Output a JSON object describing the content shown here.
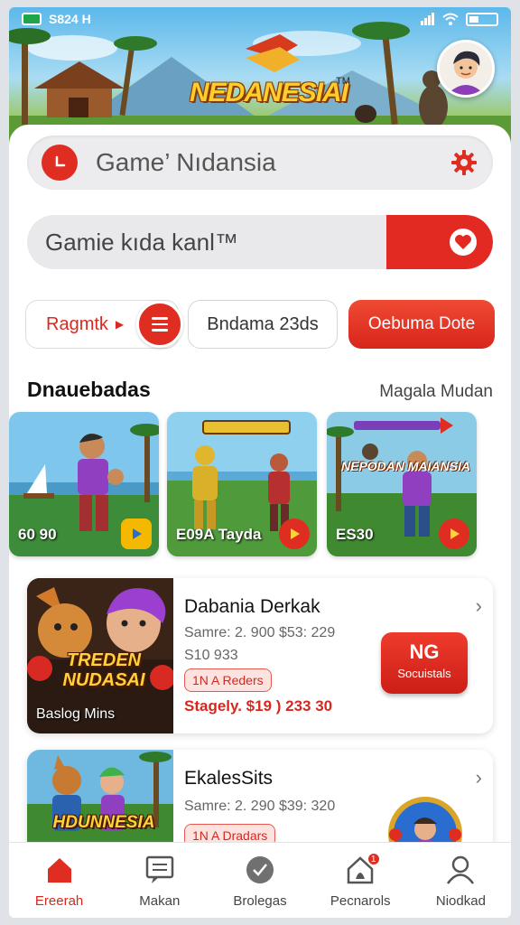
{
  "status_bar": {
    "time": "S824 H"
  },
  "hero": {
    "logo_text": "NEDANESIAI",
    "logo_mark": "TM"
  },
  "search": {
    "value": "Game’ Nıdansia"
  },
  "search2": {
    "value": "Gamie kıda kanl™"
  },
  "chips": {
    "first": "Ragmtk",
    "second": "Bndama 23ds",
    "third": "Oebuma Dote"
  },
  "section": {
    "title": "Dnauebadas",
    "link": "Magala Mudan"
  },
  "tiles": [
    {
      "label": "60 90",
      "banner": ""
    },
    {
      "label": "E09A Tayda",
      "banner": ""
    },
    {
      "label": "ES30",
      "banner": "NEPODAN MAIANSIA"
    }
  ],
  "cards": [
    {
      "title": "Dabania Derkak",
      "meta1": "Samre: 2. 900  $53: 229",
      "meta2": "S10 933",
      "pill": "1N A Reders",
      "price": "Stagely. $19 ) 233 30",
      "thumb_title": "TREDEN NUDASAI",
      "thumb_caption": "Baslog Mins",
      "cta_big": "NG",
      "cta_small": "Socuistals"
    },
    {
      "title": "EkalesSits",
      "meta1": "Samre: 2. 290  $39: 320",
      "pill": "1N A Dradars",
      "thumb_title": "HDUNNESIA"
    }
  ],
  "nav": [
    {
      "label": "Ereerah",
      "icon": "home-icon",
      "active": true
    },
    {
      "label": "Makan",
      "icon": "message-icon"
    },
    {
      "label": "Brolegas",
      "icon": "badge-icon"
    },
    {
      "label": "Pecnarols",
      "icon": "notification-house-icon",
      "badge": "1"
    },
    {
      "label": "Niodkad",
      "icon": "profile-icon"
    }
  ],
  "colors": {
    "accent": "#e02d22",
    "background": "#ffffff"
  }
}
